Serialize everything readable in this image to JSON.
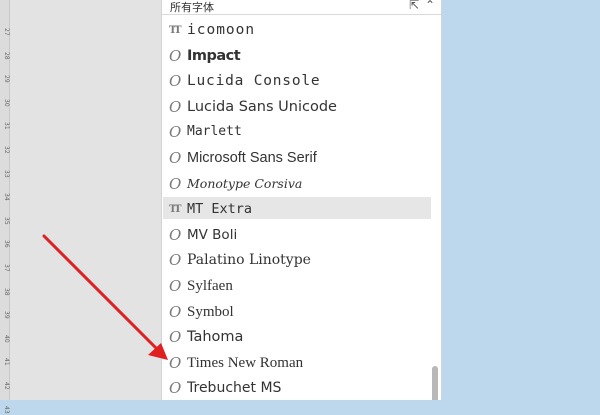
{
  "panel": {
    "title": "所有字体",
    "pin_icon": "pin-icon",
    "collapse_icon": "chevron-up-icon"
  },
  "ruler": {
    "labels": [
      "27",
      "28",
      "29",
      "30",
      "31",
      "32",
      "33",
      "34",
      "35",
      "36",
      "37",
      "38",
      "39",
      "40",
      "41",
      "42",
      "43"
    ]
  },
  "fonts": [
    {
      "name": "icomoon",
      "icon": "truetype-font-icon"
    },
    {
      "name": "Impact",
      "icon": "opentype-font-icon"
    },
    {
      "name": "Lucida Console",
      "icon": "opentype-font-icon"
    },
    {
      "name": "Lucida Sans Unicode",
      "icon": "opentype-font-icon"
    },
    {
      "name": "Marlett",
      "icon": "opentype-font-icon"
    },
    {
      "name": "Microsoft Sans Serif",
      "icon": "opentype-font-icon"
    },
    {
      "name": "Monotype Corsiva",
      "icon": "opentype-font-icon"
    },
    {
      "name": "MT Extra",
      "icon": "truetype-font-icon",
      "selected": true
    },
    {
      "name": "MV Boli",
      "icon": "opentype-font-icon"
    },
    {
      "name": "Palatino Linotype",
      "icon": "opentype-font-icon"
    },
    {
      "name": "Sylfaen",
      "icon": "opentype-font-icon"
    },
    {
      "name": "Symbol",
      "icon": "opentype-font-icon"
    },
    {
      "name": "Tahoma",
      "icon": "opentype-font-icon"
    },
    {
      "name": "Times New Roman",
      "icon": "opentype-font-icon"
    },
    {
      "name": "Trebuchet MS",
      "icon": "opentype-font-icon"
    }
  ],
  "colors": {
    "background": "#bdd7ec",
    "selected_row": "#e6e6e6",
    "arrow": "#e02020"
  }
}
